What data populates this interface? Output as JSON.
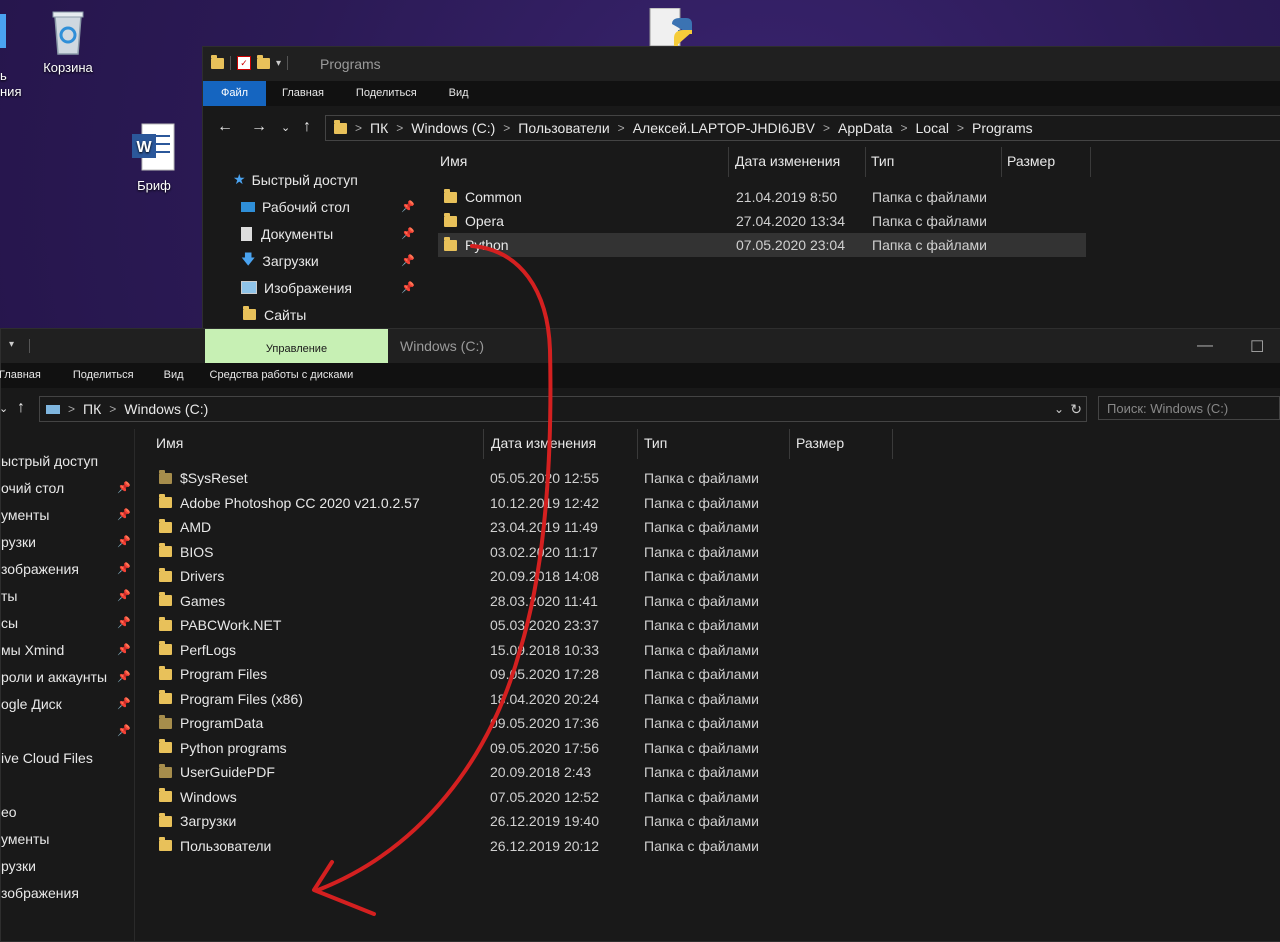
{
  "desktop": {
    "icons": [
      {
        "label": "Корзина"
      },
      {
        "label": "Бриф"
      }
    ],
    "partial_label_1": "ь",
    "partial_label_2": "ния"
  },
  "window_top": {
    "title": "Programs",
    "ribbon_tabs": [
      "Файл",
      "Главная",
      "Поделиться",
      "Вид"
    ],
    "breadcrumb": [
      "ПК",
      "Windows (C:)",
      "Пользователи",
      "Алексей.LAPTOP-JHDI6JBV",
      "AppData",
      "Local",
      "Programs"
    ],
    "columns": [
      "Имя",
      "Дата изменения",
      "Тип",
      "Размер"
    ],
    "sidebar": [
      {
        "label": "Быстрый доступ",
        "icon": "star-icon"
      },
      {
        "label": "Рабочий стол",
        "icon": "desktop-icon",
        "pinned": true
      },
      {
        "label": "Документы",
        "icon": "documents-icon",
        "pinned": true
      },
      {
        "label": "Загрузки",
        "icon": "download-icon",
        "pinned": true
      },
      {
        "label": "Изображения",
        "icon": "pictures-icon",
        "pinned": true
      },
      {
        "label": "Сайты",
        "icon": "folder-icon",
        "pinned": false
      }
    ],
    "files": [
      {
        "name": "Common",
        "date": "21.04.2019 8:50",
        "type": "Папка с файлами"
      },
      {
        "name": "Opera",
        "date": "27.04.2020 13:34",
        "type": "Папка с файлами"
      },
      {
        "name": "Python",
        "date": "07.05.2020 23:04",
        "type": "Папка с файлами",
        "selected": true
      }
    ]
  },
  "window_bottom": {
    "title": "Windows (C:)",
    "manage_tab": "Управление",
    "ribbon_tabs": [
      "Главная",
      "Поделиться",
      "Вид",
      "Средства работы с дисками"
    ],
    "breadcrumb": [
      "ПК",
      "Windows (C:)"
    ],
    "search_placeholder": "Поиск: Windows (C:)",
    "columns": [
      "Имя",
      "Дата изменения",
      "Тип",
      "Размер"
    ],
    "sidebar": [
      {
        "label": "ыстрый доступ",
        "pinned": false
      },
      {
        "label": "очий стол",
        "pinned": true
      },
      {
        "label": "ументы",
        "pinned": true
      },
      {
        "label": "рузки",
        "pinned": true
      },
      {
        "label": "зображения",
        "pinned": true
      },
      {
        "label": "ты",
        "pinned": true
      },
      {
        "label": "сы",
        "pinned": true
      },
      {
        "label": "мы Xmind",
        "pinned": true
      },
      {
        "label": "роли и аккаунты",
        "pinned": true
      },
      {
        "label": "ogle Диск",
        "pinned": true
      },
      {
        "label": "",
        "pinned": true
      },
      {
        "label": "ive Cloud Files",
        "pinned": false
      },
      {
        "label": "",
        "pinned": false
      },
      {
        "label": "ео",
        "pinned": false
      },
      {
        "label": "ументы",
        "pinned": false
      },
      {
        "label": "рузки",
        "pinned": false
      },
      {
        "label": "зображения",
        "pinned": false
      }
    ],
    "files": [
      {
        "name": "$SysReset",
        "date": "05.05.2020 12:55",
        "type": "Папка с файлами",
        "dim": true
      },
      {
        "name": "Adobe Photoshop CC 2020 v21.0.2.57",
        "date": "10.12.2019 12:42",
        "type": "Папка с файлами"
      },
      {
        "name": "AMD",
        "date": "23.04.2019 11:49",
        "type": "Папка с файлами"
      },
      {
        "name": "BIOS",
        "date": "03.02.2020 11:17",
        "type": "Папка с файлами"
      },
      {
        "name": "Drivers",
        "date": "20.09.2018 14:08",
        "type": "Папка с файлами"
      },
      {
        "name": "Games",
        "date": "28.03.2020 11:41",
        "type": "Папка с файлами"
      },
      {
        "name": "PABCWork.NET",
        "date": "05.03.2020 23:37",
        "type": "Папка с файлами"
      },
      {
        "name": "PerfLogs",
        "date": "15.09.2018 10:33",
        "type": "Папка с файлами"
      },
      {
        "name": "Program Files",
        "date": "09.05.2020 17:28",
        "type": "Папка с файлами"
      },
      {
        "name": "Program Files (x86)",
        "date": "18.04.2020 20:24",
        "type": "Папка с файлами"
      },
      {
        "name": "ProgramData",
        "date": "09.05.2020 17:36",
        "type": "Папка с файлами",
        "dim": true
      },
      {
        "name": "Python programs",
        "date": "09.05.2020 17:56",
        "type": "Папка с файлами"
      },
      {
        "name": "UserGuidePDF",
        "date": "20.09.2018 2:43",
        "type": "Папка с файлами",
        "dim": true
      },
      {
        "name": "Windows",
        "date": "07.05.2020 12:52",
        "type": "Папка с файлами"
      },
      {
        "name": "Загрузки",
        "date": "26.12.2019 19:40",
        "type": "Папка с файлами"
      },
      {
        "name": "Пользователи",
        "date": "26.12.2019 20:12",
        "type": "Папка с файлами"
      }
    ]
  },
  "annotation": {
    "color": "#d42020"
  }
}
